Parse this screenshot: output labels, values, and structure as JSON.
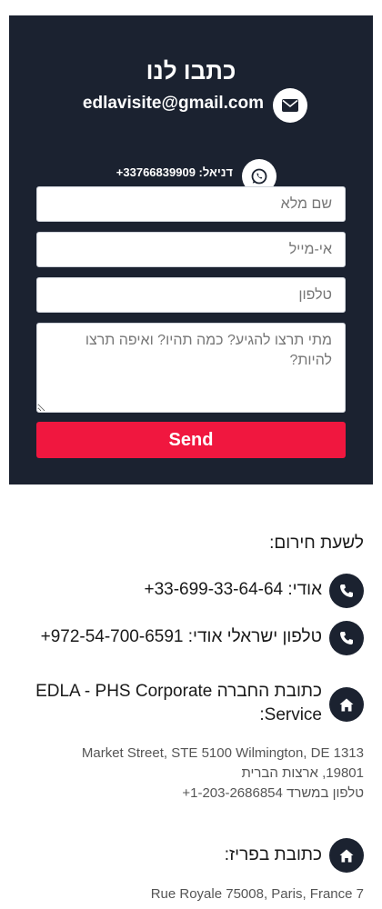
{
  "panel": {
    "title": "כתבו לנו",
    "email": "edlavisite@gmail.com",
    "whatsapp": "דניאל: 33766839909+"
  },
  "form": {
    "name_placeholder": "שם מלא",
    "email_placeholder": "אי-מייל",
    "phone_placeholder": "טלפון",
    "message_placeholder": "מתי תרצו להגיע? כמה תהיו? ואיפה תרצו להיות?",
    "send_label": "Send"
  },
  "info": {
    "emergency_heading": "לשעת חירום:",
    "phone1": "אודי: 33-699-33-64-64+",
    "phone2": "טלפון ישראלי אודי: 972-54-700-6591+",
    "corp_title": "כתובת החברה EDLA - PHS Corporate Service:",
    "corp_address_line1": "Market Street, STE 5100 Wilmington, DE 1313",
    "corp_address_line2": "19801, ארצות הברית",
    "corp_address_line3": "טלפון במשרד 1-203-2686854+",
    "paris_title": "כתובת בפריז:",
    "paris_address": "7 Rue Royale 75008, Paris, France"
  },
  "icons": {
    "email": "envelope-icon",
    "whatsapp": "whatsapp-icon",
    "phone": "phone-icon",
    "home": "home-icon"
  },
  "colors": {
    "panel_bg": "#1b2230",
    "send_button": "#f0173f"
  }
}
